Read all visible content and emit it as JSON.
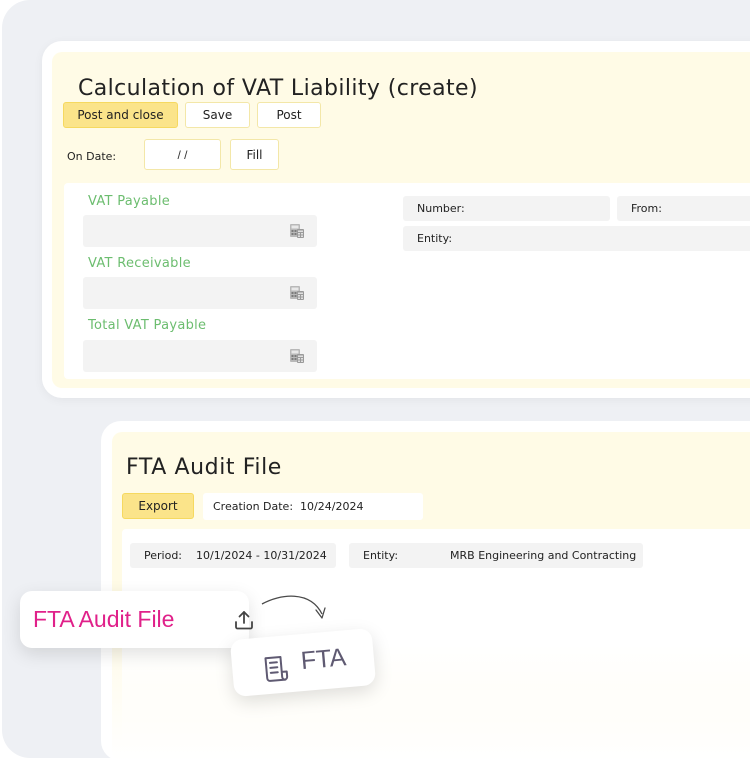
{
  "vat_window": {
    "title": "Calculation of VAT Liability (create)",
    "toolbar": {
      "post_close_label": "Post and close",
      "save_label": "Save",
      "post_label": "Post"
    },
    "on_date_label": "On Date:",
    "date_value": "/  /",
    "fill_label": "Fill",
    "fields": {
      "vat_payable_label": "VAT Payable",
      "vat_receivable_label": "VAT Receivable",
      "total_vat_payable_label": "Total VAT Payable"
    },
    "info": {
      "number_label": "Number:",
      "from_label": "From:",
      "entity_label": "Entity:"
    },
    "icons": {
      "calculator": "calculator-icon"
    }
  },
  "audit_window": {
    "title": "FTA Audit File",
    "export_label": "Export",
    "creation_date_label": "Creation Date:",
    "creation_date_value": "10/24/2024",
    "period_label": "Period:",
    "period_value": "10/1/2024 - 10/31/2024",
    "entity_label": "Entity:",
    "entity_value": "MRB Engineering and Contracting"
  },
  "chips": {
    "audit_file_label": "FTA Audit File",
    "fta_label": "FTA",
    "icons": {
      "upload": "upload-icon",
      "document": "document-icon",
      "arrow": "curved-arrow-icon"
    }
  },
  "colors": {
    "accent_yellow": "#fbe48a",
    "panel_yellow": "#fffbe6",
    "label_green": "#6cbd6f",
    "brand_magenta": "#e0218a",
    "chip_gray": "#5f5a72"
  }
}
